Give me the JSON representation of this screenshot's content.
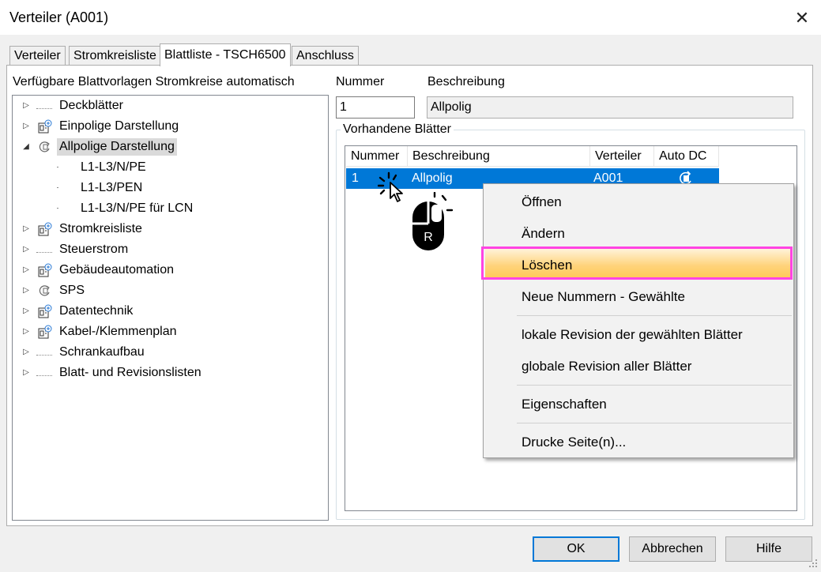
{
  "window": {
    "title": "Verteiler  (A001)",
    "close_glyph": "✕"
  },
  "tabs": [
    {
      "label": "Verteiler",
      "active": false
    },
    {
      "label": "Stromkreisliste",
      "active": false
    },
    {
      "label": "Blattliste - TSCH6500",
      "active": true
    },
    {
      "label": "Anschluss",
      "active": false
    }
  ],
  "left_panel": {
    "heading": "Verfügbare Blattvorlagen Stromkreise automatisch",
    "tree": [
      {
        "label": "Deckblätter",
        "icon": "dotted-connector-icon",
        "expanded": false
      },
      {
        "label": "Einpolige Darstellung",
        "icon": "schematic-plus-icon",
        "expanded": false
      },
      {
        "label": "Allpolige Darstellung",
        "icon": "refresh-circle-icon",
        "expanded": true,
        "selected": true,
        "children": [
          "L1-L3/N/PE",
          "L1-L3/PEN",
          "L1-L3/N/PE für LCN"
        ]
      },
      {
        "label": "Stromkreisliste",
        "icon": "schematic-plus-icon",
        "expanded": false
      },
      {
        "label": "Steuerstrom",
        "icon": "dotted-connector-icon",
        "expanded": false
      },
      {
        "label": "Gebäudeautomation",
        "icon": "schematic-plus-icon",
        "expanded": false
      },
      {
        "label": "SPS",
        "icon": "refresh-circle-icon",
        "expanded": false
      },
      {
        "label": "Datentechnik",
        "icon": "schematic-plus-icon",
        "expanded": false
      },
      {
        "label": "Kabel-/Klemmenplan",
        "icon": "schematic-plus-icon",
        "expanded": false
      },
      {
        "label": "Schrankaufbau",
        "icon": "dotted-connector-icon",
        "expanded": false
      },
      {
        "label": "Blatt- und Revisionslisten",
        "icon": "dotted-connector-icon",
        "expanded": false
      }
    ]
  },
  "fields": {
    "nummer_label": "Nummer",
    "nummer_value": "1",
    "beschreibung_label": "Beschreibung",
    "beschreibung_value": "Allpolig"
  },
  "sheets": {
    "group_label": "Vorhandene Blätter",
    "columns": [
      "Nummer",
      "Beschreibung",
      "Verteiler",
      "Auto DC"
    ],
    "rows": [
      {
        "nummer": "1",
        "beschreibung": "Allpolig",
        "verteiler": "A001",
        "auto_dc_icon": "refresh-sheet-icon",
        "selected": true
      }
    ]
  },
  "overlay": {
    "mouse_button_letter": "R"
  },
  "context_menu": {
    "items": [
      {
        "label": "Öffnen"
      },
      {
        "label": "Ändern"
      },
      {
        "label": "Löschen",
        "highlighted": true
      },
      {
        "label": "Neue Nummern - Gewählte"
      },
      {
        "label": "lokale Revision der gewählten Blätter"
      },
      {
        "label": "globale Revision aller Blätter"
      },
      {
        "label": "Eigenschaften"
      },
      {
        "label": "Drucke Seite(n)..."
      }
    ],
    "highlight_color": "#ffd37a",
    "outline_color": "#ff44e3"
  },
  "buttons": {
    "ok": "OK",
    "cancel": "Abbrechen",
    "help": "Hilfe"
  },
  "colors": {
    "selection": "#0078d7",
    "tree_selection": "#dadada"
  }
}
